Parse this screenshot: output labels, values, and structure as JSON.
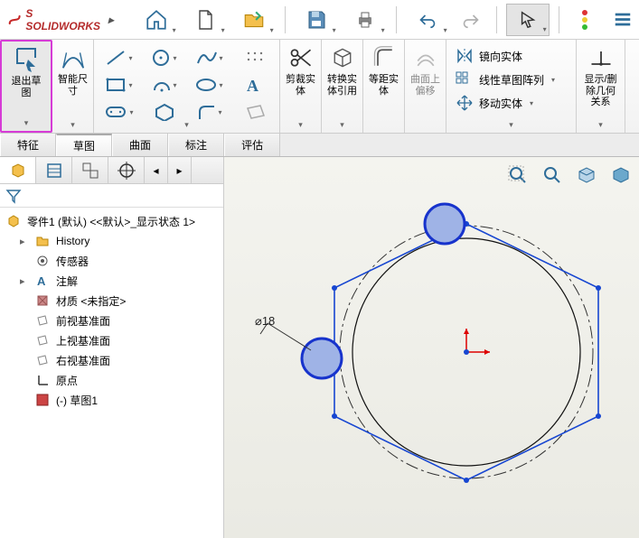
{
  "app": {
    "brand": "SOLIDWORKS"
  },
  "ribbon": {
    "exit_sketch": "退出草\n图",
    "smart_dim": "智能尺\n寸",
    "trim": "剪裁实\n体",
    "convert": "转换实\n体引用",
    "offset": "等距实\n体",
    "surface_offset": "曲面上\n偏移",
    "mirror": "镜向实体",
    "pattern": "线性草图阵列",
    "move": "移动实体",
    "display": "显示/删\n除几何\n关系"
  },
  "tabs": [
    "特征",
    "草图",
    "曲面",
    "标注",
    "评估"
  ],
  "tree": {
    "root": "零件1 (默认) <<默认>_显示状态 1>",
    "items": [
      {
        "icon": "history",
        "label": "History"
      },
      {
        "icon": "sensor",
        "label": "传感器"
      },
      {
        "icon": "annotation",
        "label": "注解"
      },
      {
        "icon": "material",
        "label": "材质 <未指定>"
      },
      {
        "icon": "plane",
        "label": "前视基准面"
      },
      {
        "icon": "plane",
        "label": "上视基准面"
      },
      {
        "icon": "plane",
        "label": "右视基准面"
      },
      {
        "icon": "origin",
        "label": "原点"
      },
      {
        "icon": "sketch",
        "label": "(-) 草图1"
      }
    ]
  },
  "dim_label": "⌀18",
  "chart_data": {
    "type": "diagram",
    "note": "Hexagon inscribed with circle; dimension ⌀18; two blue filled circles at vertices",
    "hexagon_vertices_rel": [
      [
        0.5,
        0.04
      ],
      [
        0.97,
        0.28
      ],
      [
        0.97,
        0.76
      ],
      [
        0.5,
        1.0
      ],
      [
        0.03,
        0.76
      ],
      [
        0.03,
        0.28
      ]
    ],
    "construction_circle_center_rel": [
      0.5,
      0.52
    ],
    "filled_anchor_vertices": [
      0,
      5
    ]
  }
}
